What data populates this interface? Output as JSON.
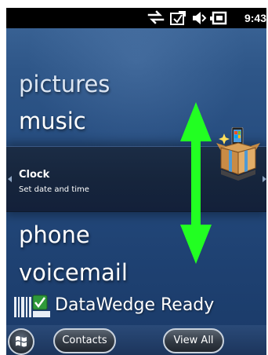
{
  "status_bar": {
    "time": "9:43",
    "icons": [
      "connectivity-icon",
      "sync-icon",
      "speaker-icon",
      "battery-icon"
    ]
  },
  "menu": {
    "items": [
      {
        "label": "pictures"
      },
      {
        "label": "music"
      },
      {
        "label": "phone"
      },
      {
        "label": "voicemail"
      }
    ]
  },
  "selected": {
    "title": "Clock",
    "subtitle": "Set date and time",
    "icon": "getting-started-gift-icon"
  },
  "datawedge": {
    "label": "DataWedge Ready",
    "icon": "barcode-check-icon"
  },
  "soft_keys": {
    "start_icon": "windows-start-icon",
    "left": "Contacts",
    "right": "View All"
  },
  "colors": {
    "background_blue": "#254b7e",
    "selection_band": "#16253c",
    "overlay_arrow_green": "#22ff22"
  }
}
